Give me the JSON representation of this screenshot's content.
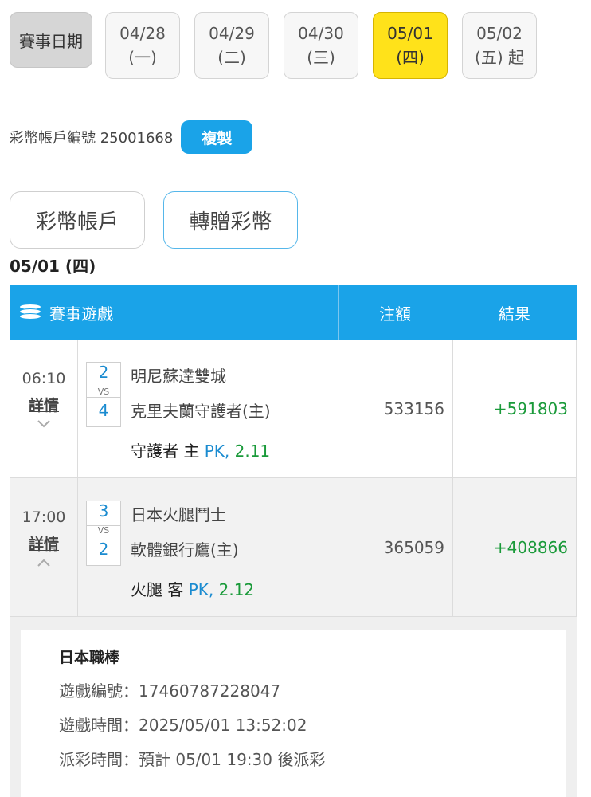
{
  "date_bar": {
    "label": "賽事日期",
    "dates": [
      {
        "date": "04/28",
        "weekday": "(一)",
        "active": false
      },
      {
        "date": "04/29",
        "weekday": "(二)",
        "active": false
      },
      {
        "date": "04/30",
        "weekday": "(三)",
        "active": false
      },
      {
        "date": "05/01",
        "weekday": "(四)",
        "active": true
      },
      {
        "date": "05/02",
        "weekday": "(五) 起",
        "active": false
      }
    ]
  },
  "account": {
    "label": "彩幣帳戶編號 25001668",
    "copy_label": "複製"
  },
  "tabs": {
    "account": "彩幣帳戶",
    "gift": "轉贈彩幣"
  },
  "section_date": "05/01 (四)",
  "table": {
    "headers": {
      "game": "賽事遊戲",
      "bet": "注額",
      "result": "結果"
    },
    "rows": [
      {
        "time": "06:10",
        "detail": "詳情",
        "score_home": "2",
        "vs": "VS",
        "score_away": "4",
        "team1": "明尼蘇達雙城",
        "team2": "克里夫蘭守護者(主)",
        "pick_team": "守護者 主 ",
        "pick_pk": "PK,",
        "pick_odds": " 2.11",
        "bet": "533156",
        "result": "+591803"
      },
      {
        "time": "17:00",
        "detail": "詳情",
        "score_home": "3",
        "vs": "VS",
        "score_away": "2",
        "team1": "日本火腿鬥士",
        "team2": "軟體銀行鷹(主)",
        "pick_team": "火腿 客 ",
        "pick_pk": "PK,",
        "pick_odds": " 2.12",
        "bet": "365059",
        "result": "+408866"
      }
    ]
  },
  "detail_panel": {
    "title": "日本職棒",
    "game_id": "遊戲編號：17460787228047",
    "game_time": "遊戲時間：2025/05/01 13:52:02",
    "payout_time": "派彩時間：預計 05/01 19:30 後派彩"
  }
}
